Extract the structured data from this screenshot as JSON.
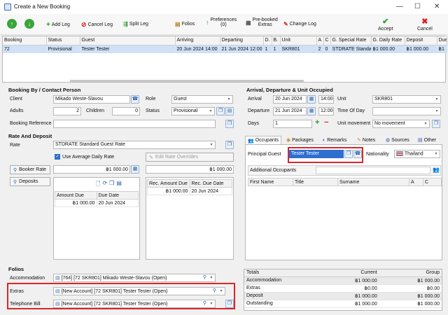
{
  "window": {
    "title": "Create a New Booking",
    "minimize": "—",
    "maximize": "☐",
    "close": "✕"
  },
  "toolbar": {
    "add_leg": "Add Leg",
    "cancel_leg": "Cancel Leg",
    "split_leg": "Split Leg",
    "folios": "Folios",
    "preferences": "Preferences",
    "preferences_count": "(0)",
    "prebooked": "Pre-booked",
    "prebooked2": "Extras",
    "change_log": "Change Log",
    "accept": "Accept",
    "cancel": "Cancel"
  },
  "grid": {
    "headers": [
      "Booking",
      "Status",
      "Guest",
      "Arriving",
      "Departing",
      "D.",
      "B.",
      "Unit",
      "A",
      "C",
      "G. Special Rate",
      "G. Daily Rate",
      "Deposit",
      "Due"
    ],
    "row": [
      "72",
      "Provisional",
      "Tester Tester",
      "20 Jun 2024 14:00",
      "21 Jun 2024 12:00",
      "1",
      "1",
      "SKR801",
      "2",
      "0",
      "STDRATE Standa",
      "฿1 000.00",
      "฿1 000.00",
      "฿1"
    ]
  },
  "booking_by": {
    "title": "Booking By / Contact Person",
    "client_label": "Client",
    "client_value": "Mikado Weste-Slavou",
    "role_label": "Role",
    "role_value": "Guest",
    "adults_label": "Adults",
    "adults_value": "2",
    "children_label": "Children",
    "children_value": "0",
    "status_label": "Status",
    "status_value": "Provisional",
    "reference_label": "Booking Reference",
    "reference_value": ""
  },
  "rate": {
    "title": "Rate And Deposit",
    "rate_label": "Rate",
    "rate_value": "STDRATE Standard Guest Rate",
    "avg_label": "Use Average Daily Rate",
    "edit_overrides": "Edit Rate Overrides",
    "booker_rate": "Booker Rate",
    "booker_value": "฿1 000.00",
    "right_value": "฿1 000.00",
    "deposits": "Deposits",
    "dep_headers": [
      "Amount Due",
      "Due Date"
    ],
    "dep_row": [
      "฿1 000.00",
      "20 Jun 2024"
    ],
    "rec_headers": [
      "Rec. Amount Due",
      "Rec. Due Date"
    ],
    "rec_row": [
      "฿1 000.00",
      "20 Jun 2024"
    ]
  },
  "arrival": {
    "title": "Arrival, Departure & Unit Occupied",
    "arrival_label": "Arrival",
    "arrival_date": "20 Jun 2024",
    "arrival_time": "14:00",
    "unit_label": "Unit",
    "unit_value": "SKR801",
    "departure_label": "Departure",
    "departure_date": "21 Jun 2024",
    "departure_time": "12:00",
    "tod_label": "Time Of Day",
    "tod_value": "",
    "days_label": "Days",
    "days_value": "1",
    "movement_label": "Unit movement",
    "movement_value": "No movement"
  },
  "tabs": [
    "Occupants",
    "Packages",
    "Remarks",
    "Notes",
    "Sources",
    "Other"
  ],
  "occupants": {
    "principal_label": "Principal Guest",
    "principal_value": "Tester Tester",
    "nationality_label": "Nationality",
    "nationality_value": "Thailand",
    "additional": "Additional Occupants",
    "headers": [
      "First Name",
      "Title",
      "Surname",
      "A",
      "C"
    ]
  },
  "folios": {
    "title": "Folios",
    "accommodation_label": "Accommodation",
    "accommodation_value": "[764] [72 SKR801] Mikado Weste-Slavou (Open)",
    "extras_label": "Extras",
    "extras_value": "[New Account] [72 SKR801] Tester Tester (Open)",
    "telephone_label": "Telephone Bill",
    "telephone_value": "[New Account] [72 SKR801] Tester Tester (Open)"
  },
  "totals": {
    "headers": [
      "Totals",
      "Current",
      "Group"
    ],
    "rows": [
      [
        "Accommodation",
        "฿1 000.00",
        "฿1 000.00"
      ],
      [
        "Extras",
        "฿0.00",
        "฿0.00"
      ],
      [
        "Deposit",
        "฿1 000.00",
        "฿1 000.00"
      ],
      [
        "Outstanding",
        "฿1 000.00",
        "฿1 000.00"
      ]
    ]
  }
}
